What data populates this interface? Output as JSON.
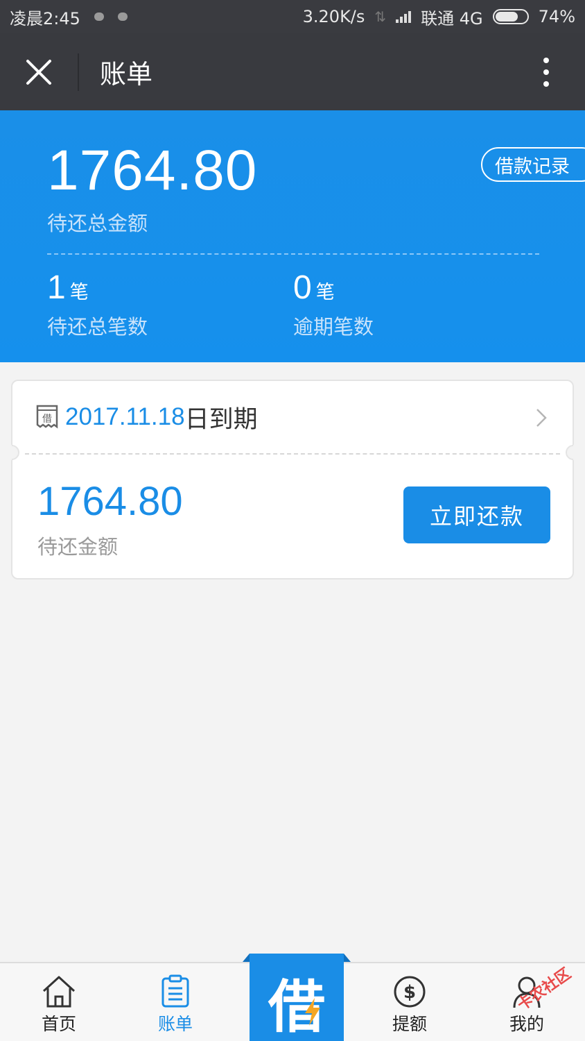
{
  "status_bar": {
    "time": "凌晨2:45",
    "speed": "3.20K/s",
    "carrier": "联通 4G",
    "battery": "74%",
    "battery_level": 0.74
  },
  "title_bar": {
    "title": "账单"
  },
  "summary": {
    "total_amount": "1764.80",
    "total_label": "待还总金额",
    "loan_records_label": "借款记录",
    "pending_count": "1",
    "pending_unit": "笔",
    "pending_label": "待还总笔数",
    "overdue_count": "0",
    "overdue_unit": "笔",
    "overdue_label": "逾期笔数"
  },
  "bill_card": {
    "icon_text": "借",
    "due_date": "2017.11.18",
    "due_suffix": "日到期",
    "amount": "1764.80",
    "amount_label": "待还金额",
    "repay_button": "立即还款"
  },
  "tabs": [
    {
      "label": "首页",
      "icon": "home-icon",
      "active": false
    },
    {
      "label": "账单",
      "icon": "bill-icon",
      "active": true
    },
    {
      "label": "借",
      "icon": "borrow-icon",
      "active": false
    },
    {
      "label": "提额",
      "icon": "dollar-icon",
      "active": false
    },
    {
      "label": "我的",
      "icon": "user-icon",
      "active": false
    }
  ],
  "watermark": "卡农社区",
  "colors": {
    "accent": "#1a8de6",
    "header": "#393a3f",
    "background": "#f3f3f3"
  }
}
